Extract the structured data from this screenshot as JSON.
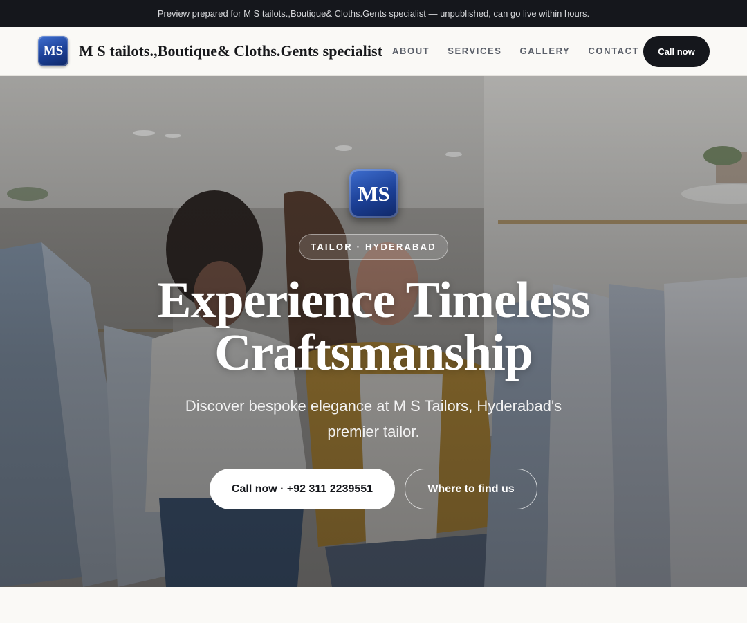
{
  "preview_banner": {
    "text": "Preview prepared for M S tailots.,Boutique& Cloths.Gents specialist — unpublished, can go live within hours."
  },
  "navbar": {
    "logo_text": "MS",
    "brand_name": "M S tailots.,Boutique& Cloths.Gents specialist",
    "links": [
      "ABOUT",
      "SERVICES",
      "GALLERY",
      "CONTACT"
    ],
    "cta_label": "Call now"
  },
  "hero": {
    "logo_text": "MS",
    "badge": "TAILOR · HYDERABAD",
    "title": "Experience Timeless Craftsmanship",
    "subtitle": "Discover bespoke elegance at M S Tailors, Hyderabad's premier tailor.",
    "primary_button": "Call now · +92 311 2239551",
    "secondary_button": "Where to find us",
    "background_image": "boutique interior with clothing racks and two women shopping"
  },
  "colors": {
    "dark": "#15171c",
    "logo_blue": "#1b3f95",
    "page_background": "#faf9f6"
  }
}
